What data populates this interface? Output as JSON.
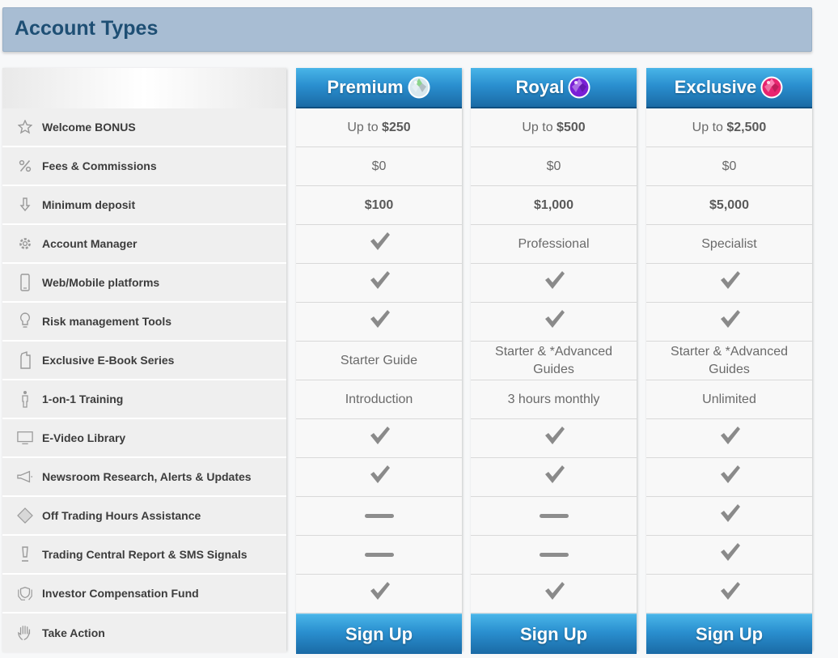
{
  "header": {
    "title": "Account Types"
  },
  "features": [
    {
      "label": "Welcome BONUS",
      "icon": "star-icon"
    },
    {
      "label": "Fees & Commissions",
      "icon": "percent-icon"
    },
    {
      "label": "Minimum deposit",
      "icon": "arrow-down-icon"
    },
    {
      "label": "Account Manager",
      "icon": "gear-icon"
    },
    {
      "label": "Web/Mobile platforms",
      "icon": "mobile-icon"
    },
    {
      "label": "Risk management Tools",
      "icon": "lightbulb-icon"
    },
    {
      "label": "Exclusive E-Book Series",
      "icon": "book-icon"
    },
    {
      "label": "1-on-1 Training",
      "icon": "person-icon"
    },
    {
      "label": "E-Video Library",
      "icon": "monitor-icon"
    },
    {
      "label": "Newsroom Research, Alerts & Updates",
      "icon": "megaphone-icon"
    },
    {
      "label": "Off Trading Hours Assistance",
      "icon": "diamond-icon"
    },
    {
      "label": "Trading Central Report & SMS Signals",
      "icon": "exclamation-icon"
    },
    {
      "label": "Investor Compensation Fund",
      "icon": "shield-hand-icon"
    },
    {
      "label": "Take Action",
      "icon": "hand-icon"
    }
  ],
  "plans": [
    {
      "name": "Premium",
      "gem_color": "#d8e8ee",
      "gem_accent": "#7fd07a",
      "bonus_prefix": "Up to",
      "bonus_amount": "$250",
      "fees": "$0",
      "min_deposit": "$100",
      "account_manager": "check",
      "web_mobile": "check",
      "risk_tools": "check",
      "ebook": "Starter Guide",
      "training": "Introduction",
      "video_library": "check",
      "newsroom": "check",
      "off_hours": "dash",
      "trading_central": "dash",
      "investor_fund": "check",
      "signup_label": "Sign Up"
    },
    {
      "name": "Royal",
      "gem_color": "#7a1fd6",
      "gem_accent": "#c08af0",
      "bonus_prefix": "Up to",
      "bonus_amount": "$500",
      "fees": "$0",
      "min_deposit": "$1,000",
      "account_manager": "Professional",
      "web_mobile": "check",
      "risk_tools": "check",
      "ebook": "Starter & *Advanced Guides",
      "training": "3 hours monthly",
      "video_library": "check",
      "newsroom": "check",
      "off_hours": "dash",
      "trading_central": "dash",
      "investor_fund": "check",
      "signup_label": "Sign Up"
    },
    {
      "name": "Exclusive",
      "gem_color": "#e8246f",
      "gem_accent": "#ff8fbf",
      "bonus_prefix": "Up to",
      "bonus_amount": "$2,500",
      "fees": "$0",
      "min_deposit": "$5,000",
      "account_manager": "Specialist",
      "web_mobile": "check",
      "risk_tools": "check",
      "ebook": "Starter & *Advanced Guides",
      "training": "Unlimited",
      "video_library": "check",
      "newsroom": "check",
      "off_hours": "check",
      "trading_central": "check",
      "investor_fund": "check",
      "signup_label": "Sign Up"
    }
  ],
  "colors": {
    "header_bg": "#a8bdd3",
    "title": "#1e4f74",
    "plan_header": "#2a8fcf",
    "check": "#8d8d8d"
  }
}
